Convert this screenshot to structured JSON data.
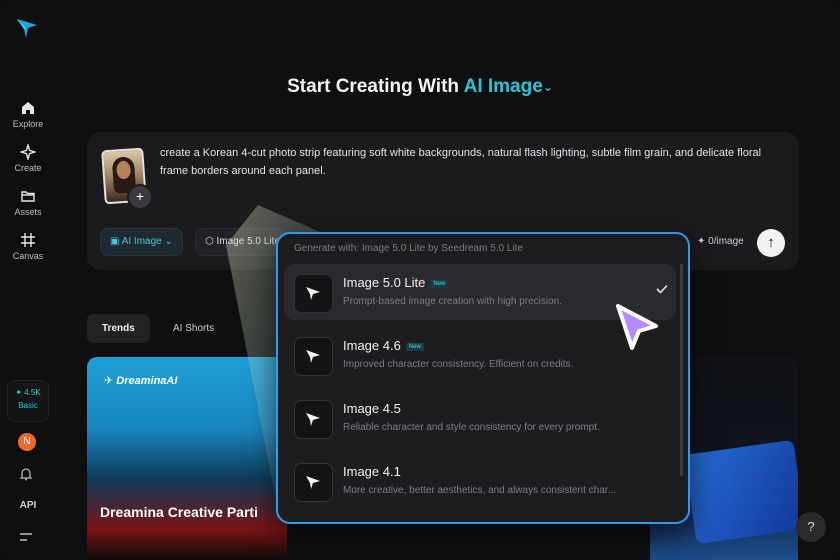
{
  "title": {
    "prefix": "Start Creating With",
    "accent": "AI Image"
  },
  "sidebar": {
    "items": [
      {
        "label": "Explore",
        "icon": "home-icon"
      },
      {
        "label": "Create",
        "icon": "sparkle-icon"
      },
      {
        "label": "Assets",
        "icon": "folder-icon"
      },
      {
        "label": "Canvas",
        "icon": "grid-icon"
      }
    ],
    "credits": {
      "value": "✦ 4.5K",
      "plan": "Basic"
    },
    "avatar_initial": "N",
    "api_label": "API"
  },
  "prompt": {
    "text": "create a Korean 4-cut photo strip featuring soft white backgrounds, natural flash lighting, subtle film grain, and delicate floral frame borders around each panel.",
    "mode_chip": "AI Image",
    "model_chip": "Image 5.0 Lite",
    "cost": "✦ 0/image"
  },
  "tabs": [
    "Trends",
    "AI Shorts"
  ],
  "gallery": {
    "brand": "DreaminaAI",
    "caption": "Dreamina Creative Parti"
  },
  "dropdown": {
    "header": "Generate with: Image 5.0 Lite by Seedream 5.0 Lite",
    "options": [
      {
        "name": "Image 5.0 Lite",
        "badge": "New",
        "desc": "Prompt-based image creation with high precision.",
        "selected": true
      },
      {
        "name": "Image 4.6",
        "badge": "New",
        "desc": "Improved character consistency. Efficient on credits.",
        "selected": false
      },
      {
        "name": "Image 4.5",
        "badge": "",
        "desc": "Reliable character and style consistency for every prompt.",
        "selected": false
      },
      {
        "name": "Image 4.1",
        "badge": "",
        "desc": "More creative, better aesthetics, and always consistent char...",
        "selected": false
      }
    ]
  },
  "colors": {
    "accent": "#26c6da",
    "dropdown_border": "#2d9cf0",
    "cursor": "#b58cff"
  }
}
